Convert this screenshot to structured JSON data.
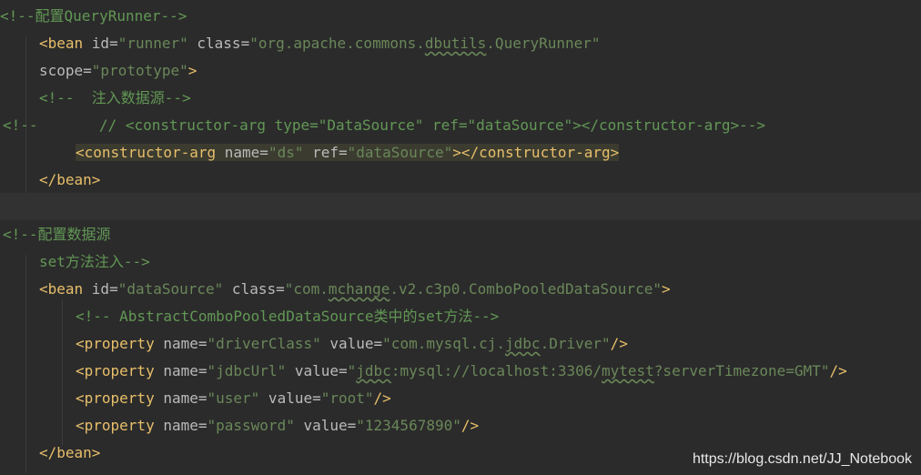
{
  "code_lines": [
    [
      {
        "t": "<!--配置QueryRunner-->",
        "k": "c-comment"
      }
    ],
    [
      {
        "t": "<bean ",
        "k": "c-tag"
      },
      {
        "t": "id=",
        "k": "c-attr"
      },
      {
        "t": "\"runner\"",
        "k": "c-val"
      },
      {
        "t": " class=",
        "k": "c-attr"
      },
      {
        "t": "\"org.apache.commons.",
        "k": "c-val"
      },
      {
        "t": "dbutils",
        "k": "c-val sq"
      },
      {
        "t": ".QueryRunner\"",
        "k": "c-val"
      }
    ],
    [
      {
        "t": "scope=",
        "k": "c-attr"
      },
      {
        "t": "\"prototype\"",
        "k": "c-val"
      },
      {
        "t": ">",
        "k": "c-tag"
      }
    ],
    [
      {
        "t": "<!--  注入数据源-->",
        "k": "c-comment"
      }
    ],
    [
      {
        "t": "<!--       // <constructor-arg type=\"DataSource\" ref=\"dataSource\"></constructor-arg>-->",
        "k": "c-comment"
      }
    ],
    [
      {
        "t": "<constructor-arg ",
        "k": "c-tag hl"
      },
      {
        "t": "name=",
        "k": "c-attr hl"
      },
      {
        "t": "\"ds\"",
        "k": "c-val hl"
      },
      {
        "t": " ref=",
        "k": "c-attr hl"
      },
      {
        "t": "\"dataSource\"",
        "k": "c-val hl"
      },
      {
        "t": "></constructor-arg>",
        "k": "c-tag hl"
      }
    ],
    [
      {
        "t": "</bean>",
        "k": "c-tag"
      }
    ],
    [],
    [
      {
        "t": "<!--配置数据源",
        "k": "c-comment"
      }
    ],
    [
      {
        "t": "set方法注入-->",
        "k": "c-comment"
      }
    ],
    [
      {
        "t": "<bean ",
        "k": "c-tag"
      },
      {
        "t": "id=",
        "k": "c-attr"
      },
      {
        "t": "\"dataSource\"",
        "k": "c-val"
      },
      {
        "t": " class=",
        "k": "c-attr"
      },
      {
        "t": "\"com.",
        "k": "c-val"
      },
      {
        "t": "mchange",
        "k": "c-val sq"
      },
      {
        "t": ".v2.c3p0.ComboPooledDataSource\"",
        "k": "c-val"
      },
      {
        "t": ">",
        "k": "c-tag"
      }
    ],
    [
      {
        "t": "<!-- AbstractComboPooledDataSource类中的set方法-->",
        "k": "c-comment"
      }
    ],
    [
      {
        "t": "<property ",
        "k": "c-tag"
      },
      {
        "t": "name=",
        "k": "c-attr"
      },
      {
        "t": "\"driverClass\"",
        "k": "c-val"
      },
      {
        "t": " value=",
        "k": "c-attr"
      },
      {
        "t": "\"com.mysql.cj.",
        "k": "c-val"
      },
      {
        "t": "jdbc",
        "k": "c-val sq"
      },
      {
        "t": ".Driver\"",
        "k": "c-val"
      },
      {
        "t": "/>",
        "k": "c-tag"
      }
    ],
    [
      {
        "t": "<property ",
        "k": "c-tag"
      },
      {
        "t": "name=",
        "k": "c-attr"
      },
      {
        "t": "\"jdbcUrl\"",
        "k": "c-val"
      },
      {
        "t": " value=",
        "k": "c-attr"
      },
      {
        "t": "\"",
        "k": "c-val"
      },
      {
        "t": "jdbc",
        "k": "c-val sq"
      },
      {
        "t": ":mysql://localhost:3306/",
        "k": "c-val"
      },
      {
        "t": "mytest",
        "k": "c-val sq"
      },
      {
        "t": "?serverTimezone=GMT\"",
        "k": "c-val"
      },
      {
        "t": "/>",
        "k": "c-tag"
      }
    ],
    [
      {
        "t": "<property ",
        "k": "c-tag"
      },
      {
        "t": "name=",
        "k": "c-attr"
      },
      {
        "t": "\"user\"",
        "k": "c-val"
      },
      {
        "t": " value=",
        "k": "c-attr"
      },
      {
        "t": "\"root\"",
        "k": "c-val"
      },
      {
        "t": "/>",
        "k": "c-tag"
      }
    ],
    [
      {
        "t": "<property ",
        "k": "c-tag"
      },
      {
        "t": "name=",
        "k": "c-attr"
      },
      {
        "t": "\"password\"",
        "k": "c-val"
      },
      {
        "t": " value=",
        "k": "c-attr"
      },
      {
        "t": "\"1234567890\"",
        "k": "c-val"
      },
      {
        "t": "/>",
        "k": "c-tag"
      }
    ],
    [
      {
        "t": "</bean>",
        "k": "c-tag"
      }
    ]
  ],
  "watermark": "https://blog.csdn.net/JJ_Notebook"
}
